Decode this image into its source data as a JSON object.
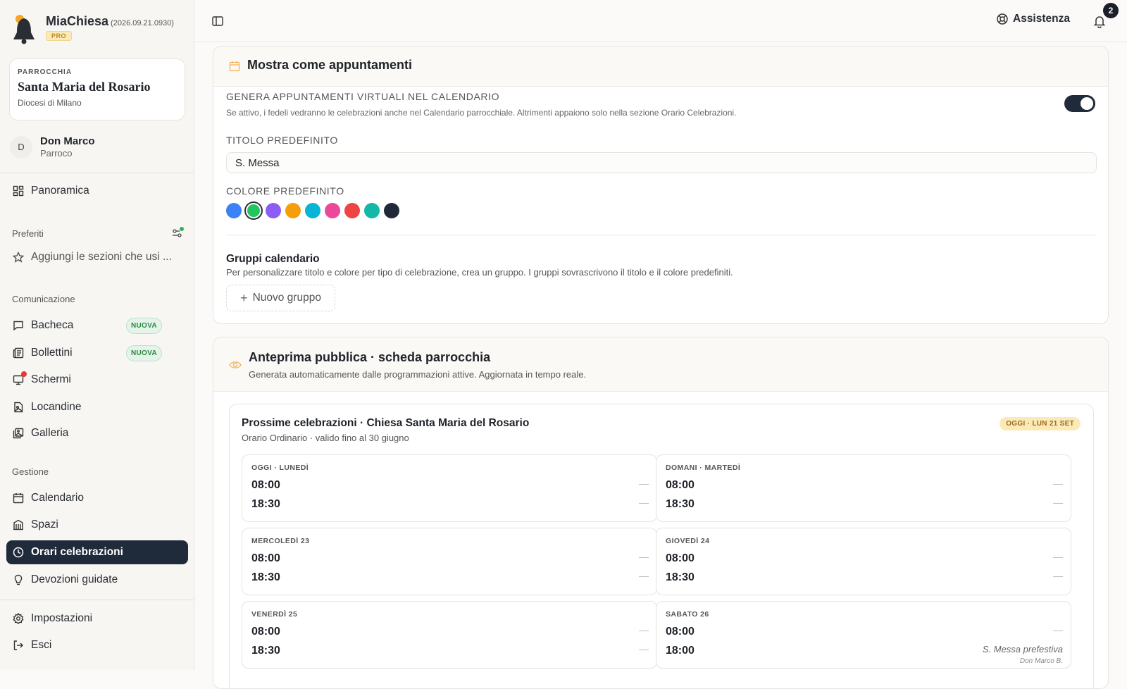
{
  "app": {
    "name": "MiaChiesa",
    "version": "(2026.09.21.0930)",
    "plan": "PRO"
  },
  "parish": {
    "kicker": "PARROCCHIA",
    "name": "Santa Maria del Rosario",
    "diocese": "Diocesi di Milano"
  },
  "user": {
    "initial": "D",
    "name": "Don Marco",
    "role": "Parroco"
  },
  "nav": {
    "overview": "Panoramica",
    "favorites_label": "Preferiti",
    "favorites_hint": "Aggiungi le sezioni che usi ...",
    "communication_label": "Comunicazione",
    "communication": [
      {
        "label": "Bacheca",
        "badge": "NUOVA"
      },
      {
        "label": "Bollettini",
        "badge": "NUOVA"
      },
      {
        "label": "Schermi"
      },
      {
        "label": "Locandine"
      },
      {
        "label": "Galleria"
      }
    ],
    "management_label": "Gestione",
    "management": [
      {
        "label": "Calendario"
      },
      {
        "label": "Spazi"
      },
      {
        "label": "Orari celebrazioni",
        "active": true
      },
      {
        "label": "Devozioni guidate"
      }
    ],
    "settings": "Impostazioni",
    "logout": "Esci"
  },
  "topbar": {
    "help": "Assistenza",
    "notifications": "2"
  },
  "appointments": {
    "title": "Mostra come appuntamenti",
    "virtual_label": "GENERA APPUNTAMENTI VIRTUALI NEL CALENDARIO",
    "virtual_desc": "Se attivo, i fedeli vedranno le celebrazioni anche nel Calendario parrocchiale. Altrimenti appaiono solo nella sezione Orario Celebrazioni.",
    "virtual_enabled": true,
    "default_title_label": "TITOLO PREDEFINITO",
    "default_title_value": "S. Messa",
    "default_color_label": "COLORE PREDEFINITO",
    "colors": [
      "#3b82f6",
      "#22c55e",
      "#8b5cf6",
      "#f59e0b",
      "#06b6d4",
      "#ec4899",
      "#ef4444",
      "#14b8a6",
      "#1f2937"
    ],
    "selected_color_index": 1,
    "groups_title": "Gruppi calendario",
    "groups_desc": "Per personalizzare titolo e colore per tipo di celebrazione, crea un gruppo. I gruppi sovrascrivono il titolo e il colore predefiniti.",
    "new_group": "Nuovo gruppo"
  },
  "preview": {
    "title": "Anteprima pubblica · scheda parrocchia",
    "subtitle": "Generata automaticamente dalle programmazioni attive. Aggiornata in tempo reale.",
    "card_title": "Prossime celebrazioni · Chiesa Santa Maria del Rosario",
    "card_subtitle": "Orario Ordinario · valido fino al 30 giugno",
    "today_badge": "OGGI · LUN 21 SET",
    "days": [
      {
        "label": "OGGI · LUNEDÌ",
        "slots": [
          {
            "time": "08:00",
            "note": "—"
          },
          {
            "time": "18:30",
            "note": "—"
          }
        ]
      },
      {
        "label": "DOMANI · MARTEDÌ",
        "slots": [
          {
            "time": "08:00",
            "note": "—"
          },
          {
            "time": "18:30",
            "note": "—"
          }
        ]
      },
      {
        "label": "MERCOLEDÌ 23",
        "slots": [
          {
            "time": "08:00",
            "note": "—"
          },
          {
            "time": "18:30",
            "note": "—"
          }
        ]
      },
      {
        "label": "GIOVEDÌ 24",
        "slots": [
          {
            "time": "08:00",
            "note": "—"
          },
          {
            "time": "18:30",
            "note": "—"
          }
        ]
      },
      {
        "label": "VENERDÌ 25",
        "slots": [
          {
            "time": "08:00",
            "note": "—"
          },
          {
            "time": "18:30",
            "note": "—"
          }
        ]
      },
      {
        "label": "SABATO 26",
        "slots": [
          {
            "time": "08:00",
            "note": "—"
          },
          {
            "time": "18:00",
            "note": "S. Messa prefestiva",
            "celebrant": "Don Marco B."
          }
        ]
      }
    ]
  }
}
